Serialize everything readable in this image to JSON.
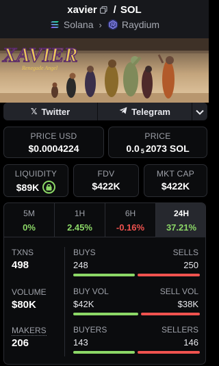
{
  "header": {
    "token_name": "xavier",
    "quote": "SOL",
    "separator": "/",
    "chain": "Solana",
    "dex": "Raydium"
  },
  "banner": {
    "logo_text": "XAVIER",
    "subtitle": "Renegade Angel"
  },
  "links": {
    "twitter": "Twitter",
    "telegram": "Telegram"
  },
  "price": {
    "usd_label": "PRICE USD",
    "usd_value": "$0.0004224",
    "sol_label": "PRICE",
    "sol_prefix": "0.0",
    "sol_zeros": "5",
    "sol_digits": "2073 SOL"
  },
  "metrics": {
    "liquidity_label": "LIQUIDITY",
    "liquidity_value": "$89K",
    "fdv_label": "FDV",
    "fdv_value": "$422K",
    "mcap_label": "MKT CAP",
    "mcap_value": "$422K"
  },
  "timeframes": [
    {
      "label": "5M",
      "change": "0%"
    },
    {
      "label": "1H",
      "change": "2.45%"
    },
    {
      "label": "6H",
      "change": "-0.16%"
    },
    {
      "label": "24H",
      "change": "37.21%"
    }
  ],
  "activity": {
    "txns_label": "TXNS",
    "txns_value": "498",
    "buys_label": "BUYS",
    "buys_value": "248",
    "sells_label": "SELLS",
    "sells_value": "250",
    "buys_ratio": 0.498,
    "volume_label": "VOLUME",
    "volume_value": "$80K",
    "buy_vol_label": "BUY VOL",
    "buy_vol_value": "$42K",
    "sell_vol_label": "SELL VOL",
    "sell_vol_value": "$38K",
    "buy_vol_ratio": 0.525,
    "makers_label": "MAKERS",
    "makers_value": "206",
    "buyers_label": "BUYERS",
    "buyers_value": "143",
    "sellers_label": "SELLERS",
    "sellers_value": "146",
    "buyers_ratio": 0.495
  },
  "colors": {
    "green": "#8cd867",
    "red": "#f0534f"
  }
}
